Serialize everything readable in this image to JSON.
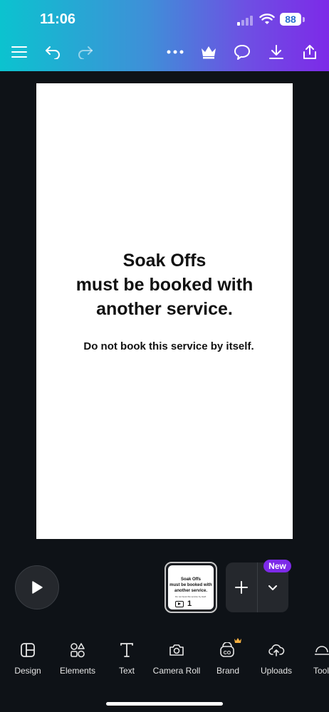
{
  "status": {
    "time": "11:06",
    "battery": "88"
  },
  "canvas": {
    "title_line1": "Soak Offs",
    "title_line2": "must be booked with",
    "title_line3": "another service.",
    "subtitle": "Do not book this service by itself."
  },
  "thumbnail": {
    "title_line1": "Soak Offs",
    "title_line2": "must be booked with",
    "title_line3": "another service.",
    "subtitle": "Do not book this service by itself.",
    "page_number": "1"
  },
  "badge": {
    "new": "New"
  },
  "nav": {
    "design": "Design",
    "elements": "Elements",
    "text": "Text",
    "camera_roll": "Camera Roll",
    "brand": "Brand",
    "uploads": "Uploads",
    "tools": "Tools"
  },
  "colors": {
    "accent": "#7d2ae8",
    "crown": "#f5b041",
    "background": "#0e1217"
  }
}
